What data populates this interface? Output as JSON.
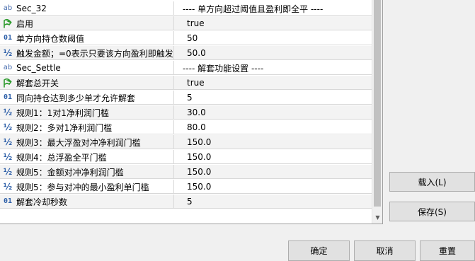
{
  "rows": [
    {
      "icon": "ab",
      "name": "Sec_32",
      "value": "---- 单方向超过阈值且盈利即全平 ----",
      "header": true
    },
    {
      "icon": "flag",
      "name": "启用",
      "value": "true"
    },
    {
      "icon": "01",
      "name": "单方向持仓数阈值",
      "value": "50"
    },
    {
      "icon": "half",
      "name": "触发金额；=0表示只要该方向盈利即触发",
      "value": "50.0"
    },
    {
      "icon": "ab",
      "name": "Sec_Settle",
      "value": "---- 解套功能设置 ----",
      "header": true
    },
    {
      "icon": "flag",
      "name": "解套总开关",
      "value": "true"
    },
    {
      "icon": "01",
      "name": "同向持仓达到多少单才允许解套",
      "value": "5"
    },
    {
      "icon": "half",
      "name": "规则1：1对1净利润门槛",
      "value": "30.0"
    },
    {
      "icon": "half",
      "name": "规则2：多对1净利润门槛",
      "value": "80.0"
    },
    {
      "icon": "half",
      "name": "规则3：最大浮盈对冲净利润门槛",
      "value": "150.0"
    },
    {
      "icon": "half",
      "name": "规则4：总浮盈全平门槛",
      "value": "150.0"
    },
    {
      "icon": "half",
      "name": "规则5：金额对冲净利润门槛",
      "value": "150.0"
    },
    {
      "icon": "half",
      "name": "规则5：参与对冲的最小盈利单门槛",
      "value": "150.0"
    },
    {
      "icon": "01",
      "name": "解套冷却秒数",
      "value": "5"
    }
  ],
  "buttons": {
    "load": "载入(L)",
    "save": "保存(S)",
    "ok": "确定",
    "cancel": "取消",
    "reset": "重置"
  },
  "icon_glyphs": {
    "ab": "ab",
    "01": "01",
    "half": "½"
  },
  "colors": {
    "icon_blue": "#2d5fa8",
    "flag_green": "#2e9b2e",
    "grid_line": "#d8d8d8"
  }
}
